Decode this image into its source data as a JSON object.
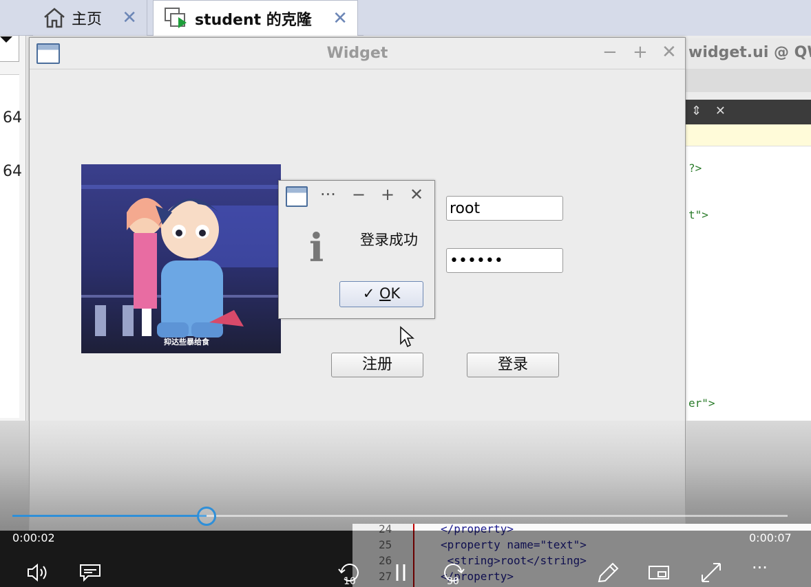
{
  "tabs": [
    {
      "label": "主页",
      "close": "✕"
    },
    {
      "label": "student 的克隆",
      "close": "✕"
    }
  ],
  "left_pane": {
    "close": "✕",
    "numbers": [
      "64",
      "64"
    ]
  },
  "editor": {
    "title": "widget.ui @ QWin",
    "code_lines": [
      "?>",
      "t\">",
      "er\">"
    ],
    "bottom_lines": [
      {
        "num": "24",
        "text": "</property>"
      },
      {
        "num": "25",
        "text": "<property name=\"text\">"
      },
      {
        "num": "26",
        "text": " <string>root</string>"
      },
      {
        "num": "27",
        "text": "</property>"
      }
    ]
  },
  "widget": {
    "title": "Widget",
    "controls": {
      "minimize": "−",
      "maximize": "+",
      "close": "✕"
    },
    "picture_caption": "抑达些暴给食",
    "username_value": "root",
    "password_value": "••••••",
    "register_label": "注册",
    "login_label": "登录"
  },
  "msgbox": {
    "controls": {
      "more": "···",
      "minimize": "−",
      "maximize": "+",
      "close": "✕"
    },
    "icon": "i",
    "message": "登录成功",
    "ok_check": "✓",
    "ok_mnemonic": "O",
    "ok_rest": "K"
  },
  "player": {
    "current_time": "0:00:02",
    "total_time": "0:00:07",
    "progress_fraction": 0.25,
    "skip_back": "10",
    "skip_forward": "30"
  }
}
